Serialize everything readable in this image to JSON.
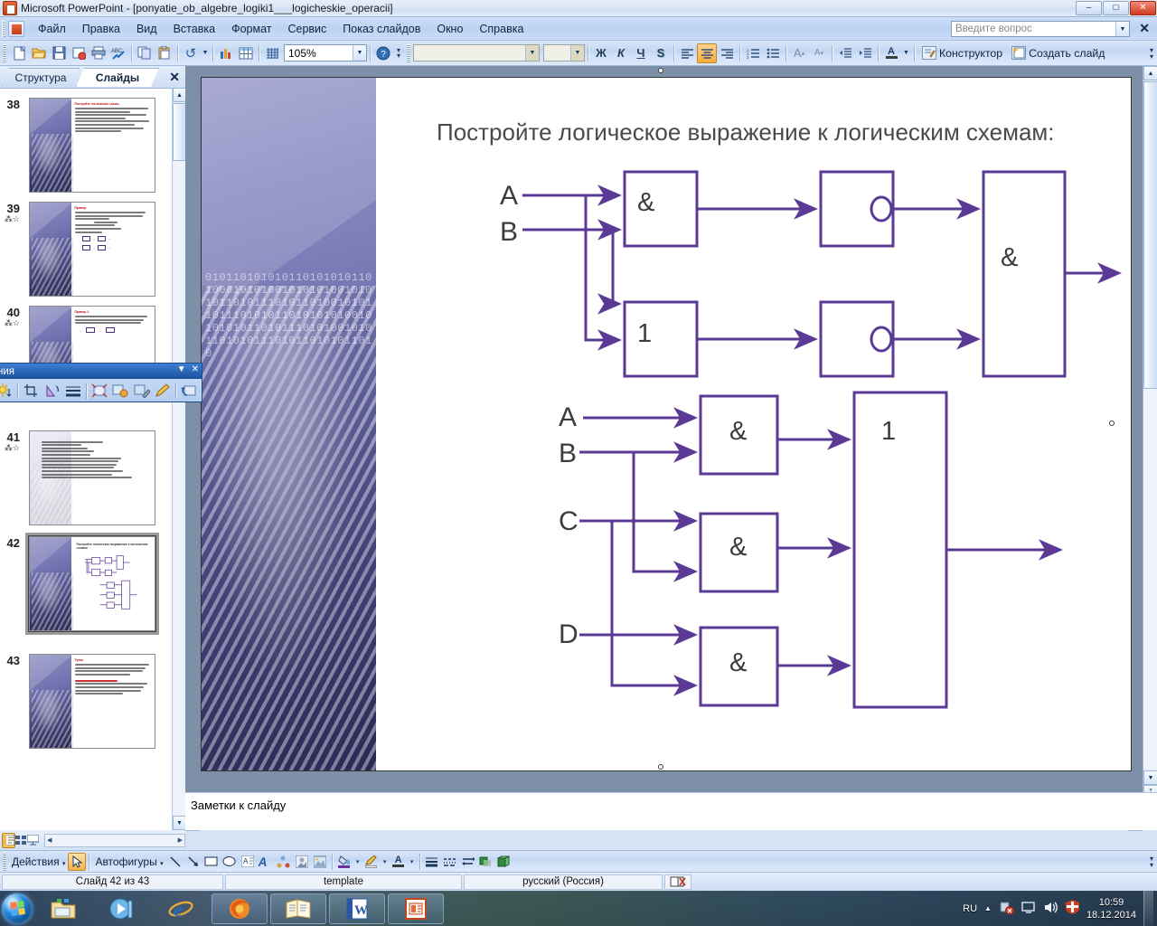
{
  "window": {
    "title": "Microsoft PowerPoint - [ponyatie_ob_algebre_logiki1___logicheskie_operacii]",
    "app_icon": "powerpoint-icon",
    "minimize": "–",
    "maximize": "□",
    "close": "✕"
  },
  "menu": {
    "items": [
      {
        "label": "Файл"
      },
      {
        "label": "Правка"
      },
      {
        "label": "Вид"
      },
      {
        "label": "Вставка"
      },
      {
        "label": "Формат"
      },
      {
        "label": "Сервис"
      },
      {
        "label": "Показ слайдов"
      },
      {
        "label": "Окно"
      },
      {
        "label": "Справка"
      }
    ],
    "ask_placeholder": "Введите вопрос",
    "close_label": "✕"
  },
  "toolbar": {
    "buttons": [
      {
        "name": "new-document-icon",
        "glyph": "🗋"
      },
      {
        "name": "open-folder-icon",
        "glyph": "📂"
      },
      {
        "name": "save-icon",
        "glyph": "💾"
      },
      {
        "name": "email-icon",
        "glyph": "📧"
      },
      {
        "name": "print-icon",
        "glyph": "🖨"
      },
      {
        "name": "spellcheck-icon",
        "glyph": "ABC"
      },
      {
        "name": "copy-icon",
        "glyph": "⧉"
      },
      {
        "name": "paste-icon",
        "glyph": "📋"
      },
      {
        "name": "undo-icon",
        "glyph": "↺"
      },
      {
        "name": "chart-icon",
        "glyph": "📊"
      },
      {
        "name": "table-icon",
        "glyph": "▦"
      },
      {
        "name": "grid-icon",
        "glyph": "▩"
      }
    ],
    "zoom_value": "105%",
    "help_icon": "help-icon",
    "font_name": "",
    "font_size": "",
    "bold_label": "Ж",
    "italic_label": "К",
    "underline_label": "Ч",
    "shadow_label": "S",
    "align_left": "left-align-icon",
    "align_center": "center-align-icon",
    "align_right": "right-align-icon",
    "numbered_list": "numbered-list-icon",
    "bulleted_list": "bulleted-list-icon",
    "grow_font": "A",
    "shrink_font": "A",
    "decrease_indent": "decrease-indent-icon",
    "increase_indent": "increase-indent-icon",
    "font_color": "A",
    "designer_label": "Конструктор",
    "new_slide_label": "Создать слайд"
  },
  "left_pane": {
    "tab_outline": "Структура",
    "tab_slides": "Слайды",
    "close_label": "✕",
    "slides": [
      {
        "number": "38",
        "title": "Постройте логические схемы",
        "lines": 8,
        "type": "text"
      },
      {
        "number": "39",
        "title": "Пример",
        "lines": 10,
        "type": "mixed"
      },
      {
        "number": "40",
        "title": "Пример 2",
        "lines": 5,
        "type": "mixed"
      },
      {
        "number": "41",
        "title": "Постройте логические схемы",
        "lines": 12,
        "type": "text"
      },
      {
        "number": "42",
        "title": "Постройте логическое выражение к логическим схемам:",
        "lines": 0,
        "type": "circuit",
        "selected": true
      },
      {
        "number": "43",
        "title": "Тупик",
        "lines": 9,
        "type": "text"
      }
    ]
  },
  "float_toolbar": {
    "title": "ния",
    "collapse_label": "▼",
    "close_label": "✕",
    "buttons": [
      {
        "name": "brightness-icon",
        "glyph": "☀"
      },
      {
        "name": "crop-icon",
        "glyph": "⊹"
      },
      {
        "name": "rotate-left-icon",
        "glyph": "◺"
      },
      {
        "name": "line-style-icon",
        "glyph": "≡"
      },
      {
        "name": "compress-picture-icon",
        "glyph": "⛶"
      },
      {
        "name": "recolor-picture-icon",
        "glyph": "🎨"
      },
      {
        "name": "format-picture-icon",
        "glyph": "🖌"
      },
      {
        "name": "set-transparent-color-icon",
        "glyph": "✎"
      },
      {
        "name": "reset-picture-icon",
        "glyph": "↺"
      }
    ]
  },
  "slide": {
    "title": "Постройте логическое выражение к логическим схемам:",
    "binary_text": "0101101010101101010101101000101010010101010010101011010111010110100101011011101010110101010100101010101101011101010010101101010111010110101011010",
    "circuit1": {
      "inputs": [
        "A",
        "B"
      ],
      "gates": [
        {
          "label": "&",
          "name": "and-gate-top"
        },
        {
          "label": "",
          "name": "not-gate-top"
        },
        {
          "label": "1",
          "name": "or-gate-bottom"
        },
        {
          "label": "",
          "name": "not-gate-bottom"
        },
        {
          "label": "&",
          "name": "and-gate-output"
        }
      ]
    },
    "circuit2": {
      "inputs": [
        "A",
        "B",
        "C",
        "D"
      ],
      "gates": [
        {
          "label": "&",
          "name": "and-gate-ab"
        },
        {
          "label": "&",
          "name": "and-gate-cb"
        },
        {
          "label": "&",
          "name": "and-gate-dc"
        },
        {
          "label": "1",
          "name": "or-gate-output"
        }
      ]
    },
    "stroke_color": "#5b3a96",
    "title_color": "#4a4a4a"
  },
  "notes": {
    "placeholder": "Заметки к слайду"
  },
  "view_bar": {
    "normal_view": "normal-view-icon",
    "sorter_view": "slide-sorter-icon",
    "slideshow_view": "slideshow-icon"
  },
  "draw_toolbar": {
    "actions_label": "Действия",
    "select_icon": "arrow-select-icon",
    "autoshapes_label": "Автофигуры",
    "tools": [
      {
        "name": "line-icon",
        "glyph": "＼"
      },
      {
        "name": "arrow-icon",
        "glyph": "↘"
      },
      {
        "name": "rectangle-icon",
        "glyph": "▭"
      },
      {
        "name": "oval-icon",
        "glyph": "◯"
      },
      {
        "name": "textbox-icon",
        "glyph": "▤"
      },
      {
        "name": "wordart-icon",
        "glyph": "A"
      },
      {
        "name": "diagram-icon",
        "glyph": "❖"
      },
      {
        "name": "clipart-icon",
        "glyph": "🖼"
      },
      {
        "name": "picture-icon",
        "glyph": "🏞"
      },
      {
        "name": "fill-color-icon",
        "glyph": "🪣"
      },
      {
        "name": "line-color-icon",
        "glyph": "🖌"
      },
      {
        "name": "font-color-icon",
        "glyph": "A"
      },
      {
        "name": "line-style-icon",
        "glyph": "▬"
      },
      {
        "name": "dash-style-icon",
        "glyph": "┅"
      },
      {
        "name": "arrow-style-icon",
        "glyph": "⇄"
      },
      {
        "name": "shadow-style-icon",
        "glyph": "▮"
      },
      {
        "name": "3d-style-icon",
        "glyph": "◰"
      }
    ]
  },
  "status_bar": {
    "slide_counter": "Слайд 42 из 43",
    "template": "template",
    "language": "русский (Россия)",
    "spellcheck_icon": "spellcheck-status-icon"
  },
  "taskbar": {
    "start_label": "start-orb",
    "items": [
      {
        "name": "explorer-icon",
        "active": false
      },
      {
        "name": "media-player-icon",
        "active": false
      },
      {
        "name": "internet-explorer-icon",
        "active": false
      },
      {
        "name": "firefox-icon",
        "active": true
      },
      {
        "name": "reader-icon",
        "active": true
      },
      {
        "name": "word-icon",
        "active": true
      },
      {
        "name": "powerpoint-icon",
        "active": true
      }
    ],
    "language_indicator": "RU",
    "tray": [
      "network-error-icon",
      "display-icon",
      "volume-icon",
      "security-shield-icon"
    ],
    "clock_time": "10:59",
    "clock_date": "18.12.2014"
  }
}
